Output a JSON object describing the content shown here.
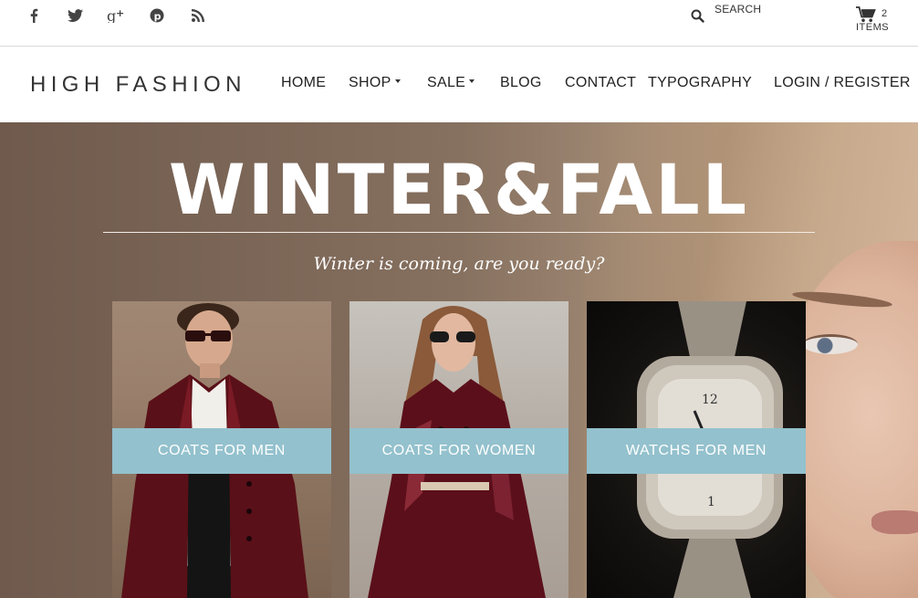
{
  "topbar": {
    "social": [
      "facebook-icon",
      "twitter-icon",
      "google-plus-icon",
      "pinterest-icon",
      "rss-icon"
    ],
    "search_label": "SEARCH",
    "cart_count": "2",
    "cart_items_label": "ITEMS"
  },
  "header": {
    "logo": "HIGH FASHION",
    "nav": [
      {
        "label": "HOME",
        "dropdown": false
      },
      {
        "label": "SHOP",
        "dropdown": true
      },
      {
        "label": "SALE",
        "dropdown": true
      },
      {
        "label": "BLOG",
        "dropdown": false
      },
      {
        "label": "CONTACT",
        "dropdown": false
      },
      {
        "label": "TYPOGRAPHY",
        "dropdown": false
      },
      {
        "label": "LOGIN / REGISTER",
        "dropdown": false
      }
    ]
  },
  "hero": {
    "title": "WINTER&FALL",
    "subtitle": "Winter is coming, are you ready?",
    "cards": [
      {
        "label": "COATS FOR MEN"
      },
      {
        "label": "COATS FOR WOMEN"
      },
      {
        "label": "WATCHS FOR MEN"
      }
    ]
  },
  "colors": {
    "accent_band": "#93c1cd",
    "text_dark": "#222222"
  }
}
